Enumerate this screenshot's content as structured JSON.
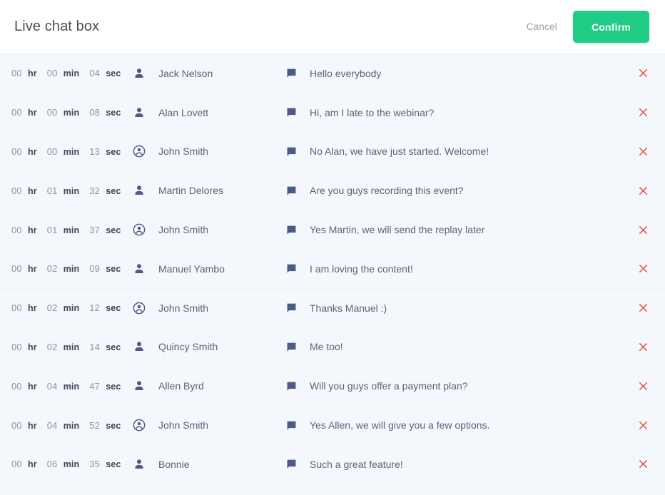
{
  "header": {
    "title": "Live chat box",
    "cancel_label": "Cancel",
    "confirm_label": "Confirm",
    "confirm_color": "#21cd86",
    "title_color": "#4a4f57",
    "cancel_color": "#9aa0ad"
  },
  "list": {
    "background_color": "#f4f8fd",
    "delete_icon_color": "#e35a5a",
    "icon_color": "#4e5a86",
    "rows": [
      {
        "hr": "00",
        "hr_unit": "hr",
        "min": "00",
        "min_unit": "min",
        "sec": "04",
        "sec_unit": "sec",
        "person_icon": "person-filled-icon",
        "name": "Jack Nelson",
        "message_icon": "chat-bubble-icon",
        "message": "Hello everybody",
        "delete_icon": "close-icon"
      },
      {
        "hr": "00",
        "hr_unit": "hr",
        "min": "00",
        "min_unit": "min",
        "sec": "08",
        "sec_unit": "sec",
        "person_icon": "person-filled-icon",
        "name": "Alan Lovett",
        "message_icon": "chat-bubble-icon",
        "message": "Hi, am I late to the webinar?",
        "delete_icon": "close-icon"
      },
      {
        "hr": "00",
        "hr_unit": "hr",
        "min": "00",
        "min_unit": "min",
        "sec": "13",
        "sec_unit": "sec",
        "person_icon": "account-circle-icon",
        "name": "John Smith",
        "message_icon": "chat-bubble-icon",
        "message": "No Alan, we have just started. Welcome!",
        "delete_icon": "close-icon"
      },
      {
        "hr": "00",
        "hr_unit": "hr",
        "min": "01",
        "min_unit": "min",
        "sec": "32",
        "sec_unit": "sec",
        "person_icon": "person-filled-icon",
        "name": "Martin Delores",
        "message_icon": "chat-bubble-icon",
        "message": "Are you guys recording this event?",
        "delete_icon": "close-icon"
      },
      {
        "hr": "00",
        "hr_unit": "hr",
        "min": "01",
        "min_unit": "min",
        "sec": "37",
        "sec_unit": "sec",
        "person_icon": "account-circle-icon",
        "name": "John Smith",
        "message_icon": "chat-bubble-icon",
        "message": "Yes Martin, we will send the replay later",
        "delete_icon": "close-icon"
      },
      {
        "hr": "00",
        "hr_unit": "hr",
        "min": "02",
        "min_unit": "min",
        "sec": "09",
        "sec_unit": "sec",
        "person_icon": "person-filled-icon",
        "name": "Manuel Yambo",
        "message_icon": "chat-bubble-icon",
        "message": "I am loving the content!",
        "delete_icon": "close-icon"
      },
      {
        "hr": "00",
        "hr_unit": "hr",
        "min": "02",
        "min_unit": "min",
        "sec": "12",
        "sec_unit": "sec",
        "person_icon": "account-circle-icon",
        "name": "John Smith",
        "message_icon": "chat-bubble-icon",
        "message": "Thanks Manuel :)",
        "delete_icon": "close-icon"
      },
      {
        "hr": "00",
        "hr_unit": "hr",
        "min": "02",
        "min_unit": "min",
        "sec": "14",
        "sec_unit": "sec",
        "person_icon": "person-filled-icon",
        "name": "Quincy Smith",
        "message_icon": "chat-bubble-icon",
        "message": "Me too!",
        "delete_icon": "close-icon"
      },
      {
        "hr": "00",
        "hr_unit": "hr",
        "min": "04",
        "min_unit": "min",
        "sec": "47",
        "sec_unit": "sec",
        "person_icon": "person-filled-icon",
        "name": "Allen Byrd",
        "message_icon": "chat-bubble-icon",
        "message": "Will you guys offer a payment plan?",
        "delete_icon": "close-icon"
      },
      {
        "hr": "00",
        "hr_unit": "hr",
        "min": "04",
        "min_unit": "min",
        "sec": "52",
        "sec_unit": "sec",
        "person_icon": "account-circle-icon",
        "name": "John Smith",
        "message_icon": "chat-bubble-icon",
        "message": "Yes Allen, we will give you a few options.",
        "delete_icon": "close-icon"
      },
      {
        "hr": "00",
        "hr_unit": "hr",
        "min": "06",
        "min_unit": "min",
        "sec": "35",
        "sec_unit": "sec",
        "person_icon": "person-filled-icon",
        "name": "Bonnie",
        "message_icon": "chat-bubble-icon",
        "message": "Such a great feature!",
        "delete_icon": "close-icon"
      }
    ]
  }
}
